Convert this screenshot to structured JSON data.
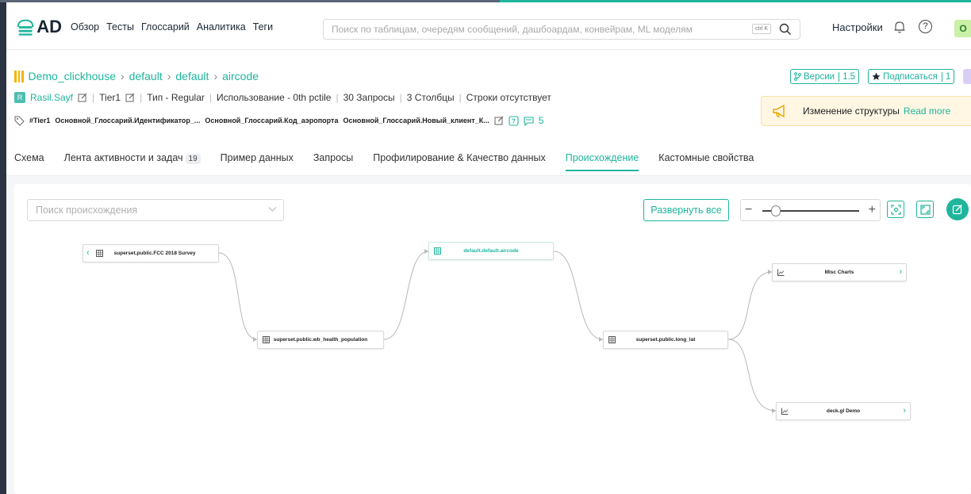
{
  "header": {
    "logo_text": "AD",
    "nav": [
      "Обзор",
      "Тесты",
      "Глоссарий",
      "Аналитика",
      "Теги"
    ],
    "search_placeholder": "Поиск по таблицам, очередям сообщений, дашбоардам, конвейрам, ML моделям",
    "search_kbd": "ctrl K",
    "settings_label": "Настройки",
    "help_label": "?",
    "user_initial": "O"
  },
  "entity": {
    "breadcrumbs": [
      "Demo_clickhouse",
      "default",
      "default",
      "aircode"
    ],
    "owner_initial": "R",
    "owner": "Rasil.Sayf",
    "tier": "Tier1",
    "type_label": "Тип - Regular",
    "usage": "Использование - 0th pctile",
    "queries": "30 Запросы",
    "columns": "3 Столбцы",
    "rows": "Строки отсутствует",
    "tags": [
      "#Tier1",
      "Основной_Глоссарий.Идентификатор_...",
      "Основной_Глоссарий.Код_аэропорта",
      "Основной_Глоссарий.Новый_клиент_К..."
    ],
    "task_count": "5",
    "versions_label": "Версии",
    "versions_value": "1.5",
    "subscribe_label": "Подписаться",
    "subscribe_value": "1"
  },
  "notice": {
    "text": "Изменение структуры",
    "link": "Read more"
  },
  "tabs": [
    {
      "label": "Схема",
      "count": ""
    },
    {
      "label": "Лента активности и задач",
      "count": "19"
    },
    {
      "label": "Пример данных",
      "count": ""
    },
    {
      "label": "Запросы",
      "count": ""
    },
    {
      "label": "Профилирование & Качество данных",
      "count": ""
    },
    {
      "label": "Происхождение",
      "count": ""
    },
    {
      "label": "Кастомные свойства",
      "count": ""
    }
  ],
  "active_tab": "Происхождение",
  "lineage": {
    "search_placeholder": "Поиск происхождения",
    "expand_all": "Развернуть все",
    "zoom_level": 0.1,
    "nodes": {
      "fcc": "superset.public.FCC 2018 Survey",
      "wb": "superset.public.wb_health_population",
      "aircode": "default.default.aircode",
      "longlat": "superset.public.long_lat",
      "misc": "Misc Charts",
      "deck": "deck.gl Demo"
    }
  },
  "colors": {
    "accent": "#1fb59c",
    "tier": "#f4b400",
    "notice_bg": "#fff7e3"
  }
}
